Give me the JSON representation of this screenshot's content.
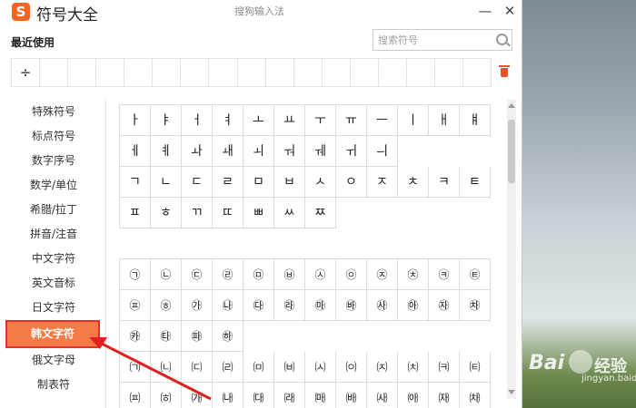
{
  "window": {
    "logo": "S",
    "title": "符号大全",
    "ime_name": "搜狗输入法",
    "minimize": "—",
    "close": "✕"
  },
  "recent": {
    "label": "最近使用",
    "items": [
      "÷",
      "",
      "",
      "",
      "",
      "",
      "",
      "",
      "",
      "",
      "",
      "",
      "",
      "",
      "",
      "",
      ""
    ],
    "trash_icon": "trash-icon"
  },
  "search": {
    "placeholder": "搜索符号",
    "value": ""
  },
  "sidebar": {
    "items": [
      {
        "label": "特殊符号",
        "active": false
      },
      {
        "label": "标点符号",
        "active": false
      },
      {
        "label": "数字序号",
        "active": false
      },
      {
        "label": "数学/单位",
        "active": false
      },
      {
        "label": "希腊/拉丁",
        "active": false
      },
      {
        "label": "拼音/注音",
        "active": false
      },
      {
        "label": "中文字符",
        "active": false
      },
      {
        "label": "英文音标",
        "active": false
      },
      {
        "label": "日文字符",
        "active": false
      },
      {
        "label": "韩文字符",
        "active": true
      },
      {
        "label": "俄文字母",
        "active": false
      },
      {
        "label": "制表符",
        "active": false
      }
    ]
  },
  "grid1": [
    [
      "ㅏ",
      "ㅑ",
      "ㅓ",
      "ㅕ",
      "ㅗ",
      "ㅛ",
      "ㅜ",
      "ㅠ",
      "ㅡ",
      "ㅣ",
      "ㅐ",
      "ㅒ"
    ],
    [
      "ㅔ",
      "ㅖ",
      "ㅘ",
      "ㅙ",
      "ㅚ",
      "ㅝ",
      "ㅞ",
      "ㅟ",
      "ㅢ"
    ],
    [
      "ㄱ",
      "ㄴ",
      "ㄷ",
      "ㄹ",
      "ㅁ",
      "ㅂ",
      "ㅅ",
      "ㅇ",
      "ㅈ",
      "ㅊ",
      "ㅋ",
      "ㅌ"
    ],
    [
      "ㅍ",
      "ㅎ",
      "ㄲ",
      "ㄸ",
      "ㅃ",
      "ㅆ",
      "ㅉ"
    ]
  ],
  "grid2": [
    [
      "㉠",
      "㉡",
      "㉢",
      "㉣",
      "㉤",
      "㉥",
      "㉦",
      "㉧",
      "㉨",
      "㉩",
      "㉪",
      "㉫"
    ],
    [
      "㉬",
      "㉭",
      "㉮",
      "㉯",
      "㉰",
      "㉱",
      "㉲",
      "㉳",
      "㉴",
      "㉵",
      "㉶",
      "㉷"
    ],
    [
      "㉸",
      "㉹",
      "㉺",
      "㉻"
    ],
    [
      "㈀",
      "㈁",
      "㈂",
      "㈃",
      "㈄",
      "㈅",
      "㈆",
      "㈇",
      "㈈",
      "㈉",
      "㈊",
      "㈋"
    ],
    [
      "㈌",
      "㈍",
      "㈎",
      "㈏",
      "㈐",
      "㈑",
      "㈒",
      "㈓",
      "㈔",
      "㈕",
      "㈖",
      "㈗"
    ]
  ],
  "watermark": {
    "brand": "Bai",
    "brand_cn": "经验",
    "sub": "jingyan.baidu.com"
  },
  "colors": {
    "accent": "#f47b45",
    "highlight_border": "#e03030",
    "logo": "#f26522"
  }
}
